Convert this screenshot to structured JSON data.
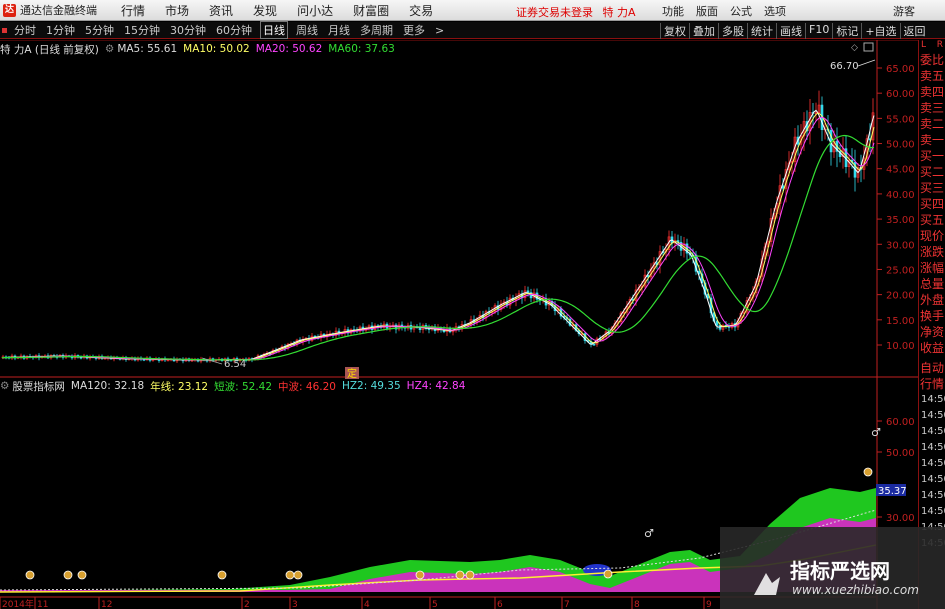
{
  "window": {
    "app_name": "通达信金融终端",
    "menu": [
      "行情",
      "市场",
      "资讯",
      "发现",
      "问小达",
      "财富圈",
      "交易"
    ],
    "login_status": "证券交易未登录",
    "stock_name": "特 力A",
    "right_menu": [
      "功能",
      "版面",
      "公式",
      "选项"
    ],
    "guest": "游客"
  },
  "period_bar": {
    "periods": [
      "分时",
      "1分钟",
      "5分钟",
      "15分钟",
      "30分钟",
      "60分钟",
      "日线",
      "周线",
      "月线",
      "多周期",
      "更多"
    ],
    "active": "日线",
    "tools": [
      "复权",
      "叠加",
      "多股",
      "统计",
      "画线",
      "F10",
      "标记",
      "+自选",
      "返回"
    ]
  },
  "main_info": {
    "title": "特 力A (日线 前复权)",
    "ma5": "MA5: 55.61",
    "ma10": "MA10: 50.02",
    "ma20": "MA20: 50.62",
    "ma60": "MA60: 37.63",
    "high_label": "66.70",
    "low_label": "6.54",
    "marker": "定"
  },
  "indicator_info": {
    "name": "股票指标网",
    "ma120": "MA120: 32.18",
    "nianxian": "年线: 23.12",
    "duanbo": "短波: 52.42",
    "zhongbo": "中波: 46.20",
    "hz2": "HZ2: 49.35",
    "hz4": "HZ4: 42.84",
    "value_box": "35.37"
  },
  "axis": {
    "price_ticks": [
      "65.00",
      "60.00",
      "55.00",
      "50.00",
      "45.00",
      "40.00",
      "35.00",
      "30.00",
      "25.00",
      "20.00",
      "15.00",
      "10.00"
    ],
    "ind_ticks": [
      "60.00",
      "50.00",
      "30.00"
    ],
    "time_labels": [
      "2014年",
      "11",
      "12",
      "2",
      "3",
      "4",
      "5",
      "6",
      "7",
      "8",
      "9"
    ]
  },
  "right_panel": {
    "items": [
      "委比",
      "卖五",
      "卖四",
      "卖三",
      "卖二",
      "卖一",
      "买一",
      "买二",
      "买三",
      "买四",
      "买五",
      "现价",
      "涨跌",
      "涨幅",
      "总量",
      "外盘",
      "换手",
      "净资",
      "收益"
    ],
    "extra": [
      "自动",
      "行情"
    ],
    "times": [
      "14:50",
      "14:50",
      "14:50",
      "14:50",
      "14:50",
      "14:50",
      "14:50",
      "14:50",
      "14:50",
      "14:50"
    ],
    "header_left": "L",
    "header_right": "R"
  },
  "watermark": {
    "title": "指标严选网",
    "url": "www.xuezhibiao.com"
  },
  "colors": {
    "ma5": "#ffffff",
    "ma10": "#ffff66",
    "ma20": "#ff44ff",
    "ma60": "#33dd33",
    "axis_red": "#c02020",
    "up": "#ff3333",
    "down": "#33ddee"
  },
  "chart_data": {
    "type": "candlestick",
    "title": "特 力A (日线 前复权)",
    "ylim": [
      6,
      67
    ],
    "x": [
      "2014-10",
      "2014-11",
      "2014-12",
      "2015-01",
      "2015-02",
      "2015-03",
      "2015-04",
      "2015-05",
      "2015-06",
      "2015-07",
      "2015-08",
      "2015-09"
    ],
    "series": [
      {
        "name": "MA5",
        "values": [
          7.5,
          7.8,
          7.2,
          7.0,
          7.4,
          11.5,
          13.5,
          14.0,
          20.0,
          12.0,
          32.0,
          55.61
        ]
      },
      {
        "name": "MA10",
        "values": [
          7.5,
          7.7,
          7.3,
          7.0,
          7.3,
          11.0,
          13.2,
          13.8,
          19.5,
          12.5,
          30.5,
          50.02
        ]
      },
      {
        "name": "MA20",
        "values": [
          7.6,
          7.6,
          7.4,
          7.1,
          7.2,
          10.5,
          12.8,
          13.5,
          18.5,
          13.5,
          28.5,
          50.62
        ]
      },
      {
        "name": "MA60",
        "values": [
          7.8,
          7.7,
          7.5,
          7.3,
          7.2,
          8.5,
          10.5,
          12.0,
          15.0,
          16.0,
          20.0,
          37.63
        ]
      }
    ],
    "price_high": 66.7,
    "price_low": 6.54
  }
}
